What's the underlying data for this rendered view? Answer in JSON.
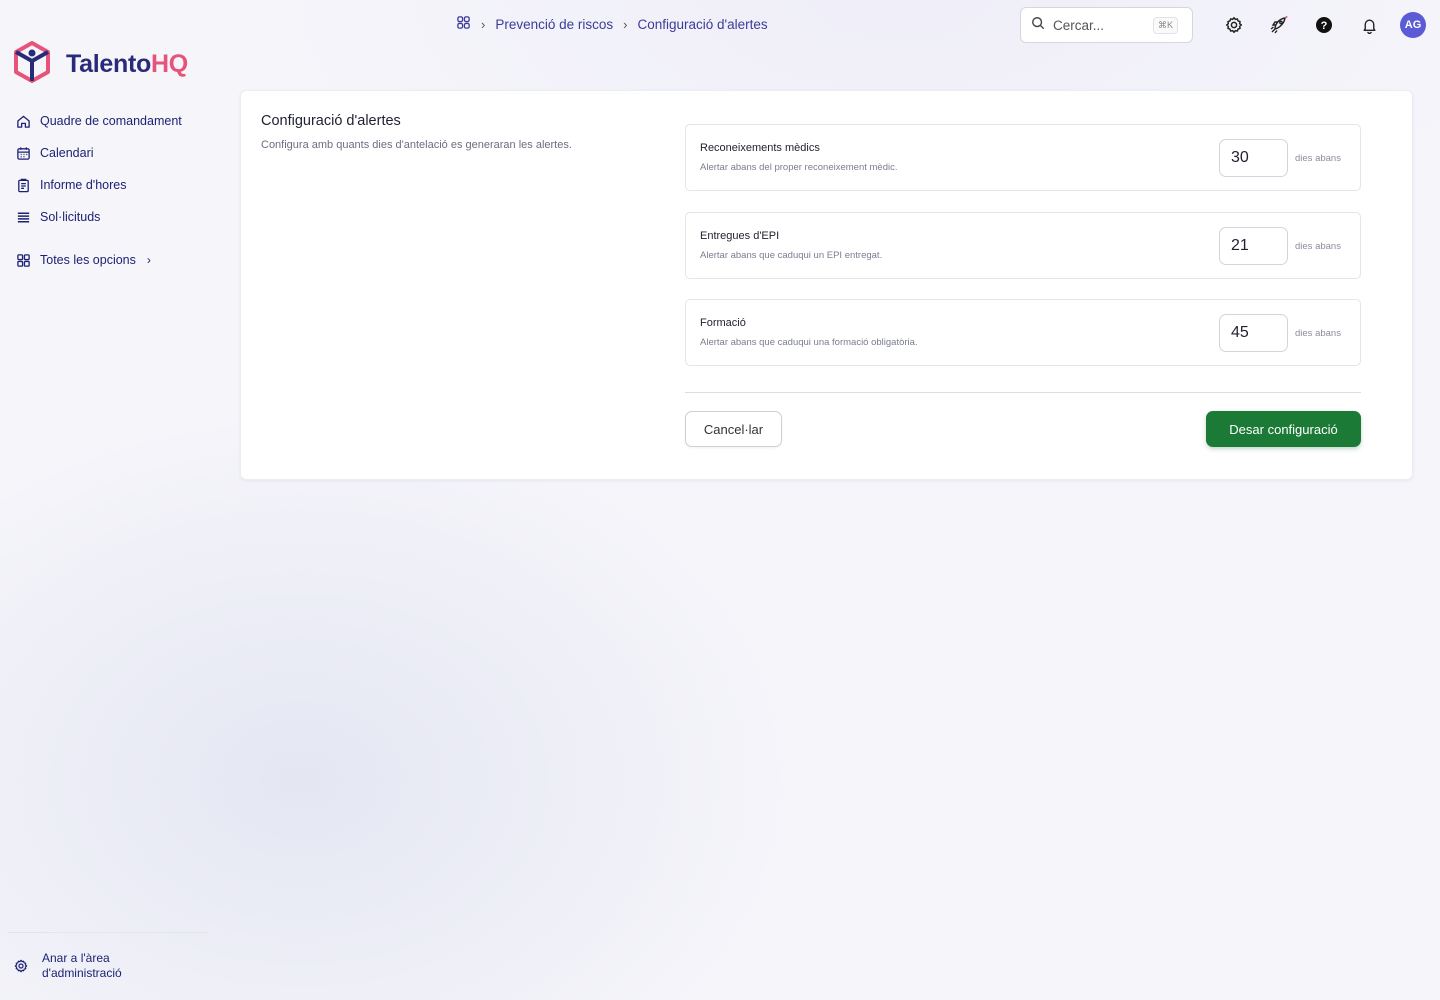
{
  "app": {
    "logo_main": "Talento",
    "logo_accent": "HQ",
    "brand_color": "#2a2a7a",
    "accent_color": "#e6537b"
  },
  "sidebar": {
    "items": [
      {
        "label": "Quadre de comandament",
        "icon": "home-icon"
      },
      {
        "label": "Calendari",
        "icon": "calendar-icon"
      },
      {
        "label": "Informe d'hores",
        "icon": "report-icon"
      },
      {
        "label": "Sol·licituds",
        "icon": "list-icon"
      }
    ],
    "all_options": {
      "label": "Totes les opcions",
      "icon": "grid-icon"
    },
    "admin_link": {
      "label": "Anar a l'àrea d'administració",
      "icon": "gear-icon"
    }
  },
  "breadcrumb": {
    "items": [
      "Prevenció de riscos",
      "Configuració d'alertes"
    ]
  },
  "search": {
    "placeholder": "Cercar...",
    "shortcut": "⌘K"
  },
  "header": {
    "avatar_initials": "AG",
    "icons": [
      "settings-icon",
      "rocket-icon",
      "help-icon",
      "bell-icon"
    ]
  },
  "main": {
    "title": "Configuració d'alertes",
    "description": "Configura amb quants dies d'antelació es generaran les alertes.",
    "settings": [
      {
        "title": "Reconeixements mèdics",
        "description": "Alertar abans del proper reconeixement mèdic.",
        "value": "30",
        "unit": "dies abans"
      },
      {
        "title": "Entregues d'EPI",
        "description": "Alertar abans que caduqui un EPI entregat.",
        "value": "21",
        "unit": "dies abans"
      },
      {
        "title": "Formació",
        "description": "Alertar abans que caduqui una formació obligatòria.",
        "value": "45",
        "unit": "dies abans"
      }
    ],
    "cancel_label": "Cancel·lar",
    "save_label": "Desar configuració",
    "save_color": "#1b7a35"
  }
}
